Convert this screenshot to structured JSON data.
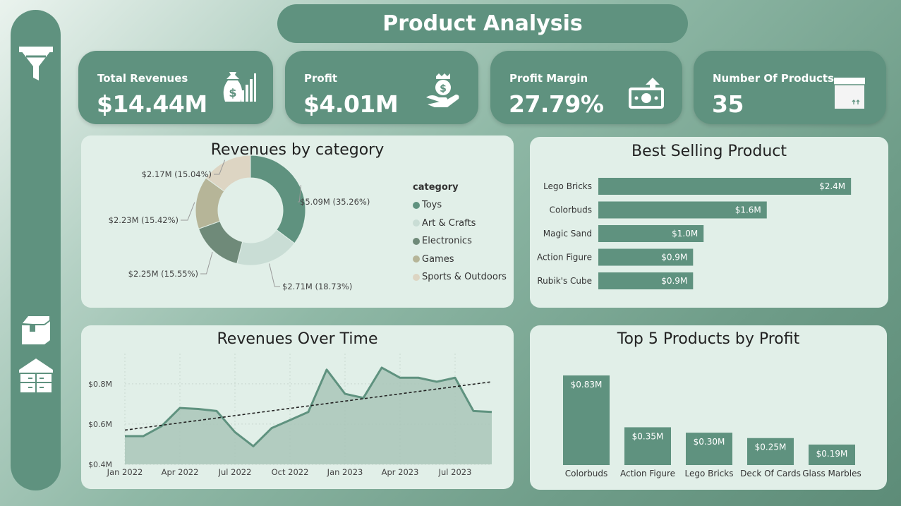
{
  "header": {
    "title": "Product Analysis"
  },
  "sidebar": {
    "icons": [
      "funnel-icon",
      "box-icon",
      "warehouse-icon"
    ]
  },
  "kpis": [
    {
      "label": "Total Revenues",
      "value": "$14.44M",
      "icon": "money-bag-chart-icon"
    },
    {
      "label": "Profit",
      "value": "$4.01M",
      "icon": "hand-money-icon"
    },
    {
      "label": "Profit Margin",
      "value": "27.79%",
      "icon": "banknote-arrow-icon"
    },
    {
      "label": "Number Of Products",
      "value": "35",
      "icon": "box-icon"
    }
  ],
  "colors": {
    "primary": "#5f927f",
    "card": "#e1efe8",
    "text": "#222222"
  },
  "chart_data": [
    {
      "type": "pie",
      "title": "Revenues by category",
      "legend_title": "category",
      "legend_position": "right",
      "slices": [
        {
          "name": "Toys",
          "value": 5.09,
          "percent": 35.26,
          "label": "$5.09M (35.26%)",
          "color": "#5f927f"
        },
        {
          "name": "Art & Crafts",
          "value": 2.71,
          "percent": 18.73,
          "label": "$2.71M (18.73%)",
          "color": "#c9ddd5"
        },
        {
          "name": "Electronics",
          "value": 2.25,
          "percent": 15.55,
          "label": "$2.25M (15.55%)",
          "color": "#6f8a79"
        },
        {
          "name": "Games",
          "value": 2.23,
          "percent": 15.42,
          "label": "$2.23M (15.42%)",
          "color": "#b6b598"
        },
        {
          "name": "Sports & Outdoors",
          "value": 2.17,
          "percent": 15.04,
          "label": "$2.17M (15.04%)",
          "color": "#ddd5c3"
        }
      ]
    },
    {
      "type": "bar",
      "orientation": "horizontal",
      "title": "Best Selling Product",
      "categories": [
        "Lego Bricks",
        "Colorbuds",
        "Magic Sand",
        "Action Figure",
        "Rubik's Cube"
      ],
      "values": [
        2.4,
        1.6,
        1.0,
        0.9,
        0.9
      ],
      "labels": [
        "$2.4M",
        "$1.6M",
        "$1.0M",
        "$0.9M",
        "$0.9M"
      ],
      "xlim": [
        0,
        2.6
      ]
    },
    {
      "type": "area",
      "title": "Revenues Over Time",
      "x": [
        "2022-01",
        "2022-02",
        "2022-03",
        "2022-04",
        "2022-05",
        "2022-06",
        "2022-07",
        "2022-08",
        "2022-09",
        "2022-10",
        "2022-11",
        "2022-12",
        "2023-01",
        "2023-02",
        "2023-03",
        "2023-04",
        "2023-05",
        "2023-06",
        "2023-07",
        "2023-08",
        "2023-09"
      ],
      "values": [
        0.54,
        0.54,
        0.59,
        0.68,
        0.675,
        0.665,
        0.56,
        0.49,
        0.58,
        0.62,
        0.66,
        0.87,
        0.75,
        0.73,
        0.88,
        0.83,
        0.83,
        0.81,
        0.83,
        0.665,
        0.66
      ],
      "trend": {
        "start": 0.57,
        "end": 0.81
      },
      "x_ticks": [
        "Jan 2022",
        "Apr 2022",
        "Jul 2022",
        "Oct 2022",
        "Jan 2023",
        "Apr 2023",
        "Jul 2023"
      ],
      "x_tick_index": [
        0,
        3,
        6,
        9,
        12,
        15,
        18
      ],
      "y_ticks": [
        {
          "value": 0.8,
          "label": "$0.8M"
        },
        {
          "value": 0.6,
          "label": "$0.6M"
        },
        {
          "value": 0.4,
          "label": "$0.4M"
        }
      ],
      "ylim": [
        0.4,
        0.95
      ],
      "grid": true
    },
    {
      "type": "bar",
      "title": "Top 5 Products by Profit",
      "categories": [
        "Colorbuds",
        "Action Figure",
        "Lego Bricks",
        "Deck Of Cards",
        "Glass Marbles"
      ],
      "values": [
        0.83,
        0.35,
        0.3,
        0.25,
        0.19
      ],
      "labels": [
        "$0.83M",
        "$0.35M",
        "$0.30M",
        "$0.25M",
        "$0.19M"
      ],
      "ylim": [
        0,
        0.9
      ]
    }
  ]
}
